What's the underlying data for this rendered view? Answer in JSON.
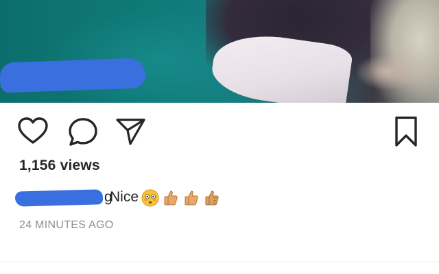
{
  "post": {
    "views": "1,156 views",
    "username_visible_tail": "g",
    "caption_text": "Nice",
    "caption_emojis": [
      "flushed-face",
      "thumbs-up",
      "thumbs-up",
      "thumbs-up"
    ],
    "timestamp": "24 MINUTES AGO"
  },
  "icons": {
    "like": "heart-icon",
    "comment": "comment-bubble-icon",
    "share": "send-paper-plane-icon",
    "save": "bookmark-icon"
  },
  "colors": {
    "text": "#262626",
    "muted": "#8e8e8e",
    "redaction": "#3a6fe0",
    "divider": "#e6e6e6"
  }
}
